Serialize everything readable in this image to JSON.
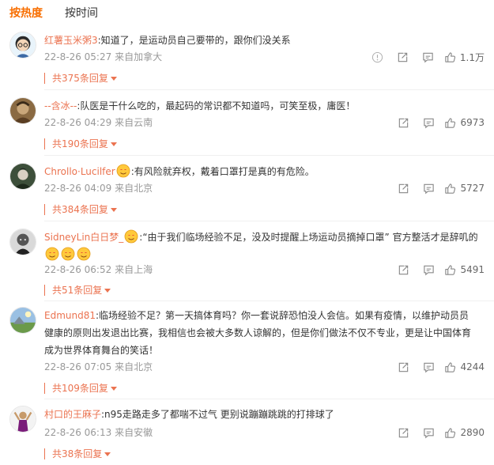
{
  "tabs": [
    "按热度",
    "按时间"
  ],
  "comments": [
    {
      "user": "红薯玉米粥3",
      "text": ":知道了，是运动员自己要带的，跟你们没关系",
      "time": "22-8-26 05:27",
      "location": "来自加拿大",
      "likes": "1.1万",
      "replies": "共375条回复"
    },
    {
      "user": "--含冰--",
      "text": ":队医是干什么吃的，最起码的常识都不知道吗，可笑至极，庸医！",
      "time": "22-8-26 04:29",
      "location": "来自云南",
      "likes": "6973",
      "replies": "共190条回复"
    },
    {
      "user": "Chrollo·Lucilfer",
      "text": ":有风险就弃权，戴着口罩打是真的有危险。",
      "time": "22-8-26 04:09",
      "location": "来自北京",
      "likes": "5727",
      "replies": "共384条回复"
    },
    {
      "user": "SidneyLin白日梦_",
      "text": ":“由于我们临场经验不足，没及时提醒上场运动员摘掉口罩” 官方整活才是辞叽的",
      "time": "22-8-26 06:52",
      "location": "来自上海",
      "likes": "5491",
      "replies": "共51条回复"
    },
    {
      "user": "Edmund81",
      "text": ":临场经验不足？第一天搞体育吗？你一套说辞恐怕没人会信。如果有疫情，以维护动员员健康的原则出发退出比赛，我相信也会被大多数人谅解的，但是你们做法不仅不专业，更是让中国体育成为世界体育舞台的笑话！",
      "time": "22-8-26 07:05",
      "location": "来自北京",
      "likes": "4244",
      "replies": "共109条回复"
    },
    {
      "user": "村口的王麻子",
      "text": ":n95走路走多了都喘不过气 更别说蹦蹦跳跳的打排球了",
      "time": "22-8-26 06:13",
      "location": "来自安徽",
      "likes": "2890",
      "replies": "共38条回复"
    }
  ],
  "colors": {
    "accent": "#f86e00",
    "link": "#eb7350",
    "meta": "#999999"
  },
  "icons": [
    "report-icon",
    "share-icon",
    "comment-icon",
    "like-icon",
    "emoji-icon",
    "caret-down-icon"
  ]
}
